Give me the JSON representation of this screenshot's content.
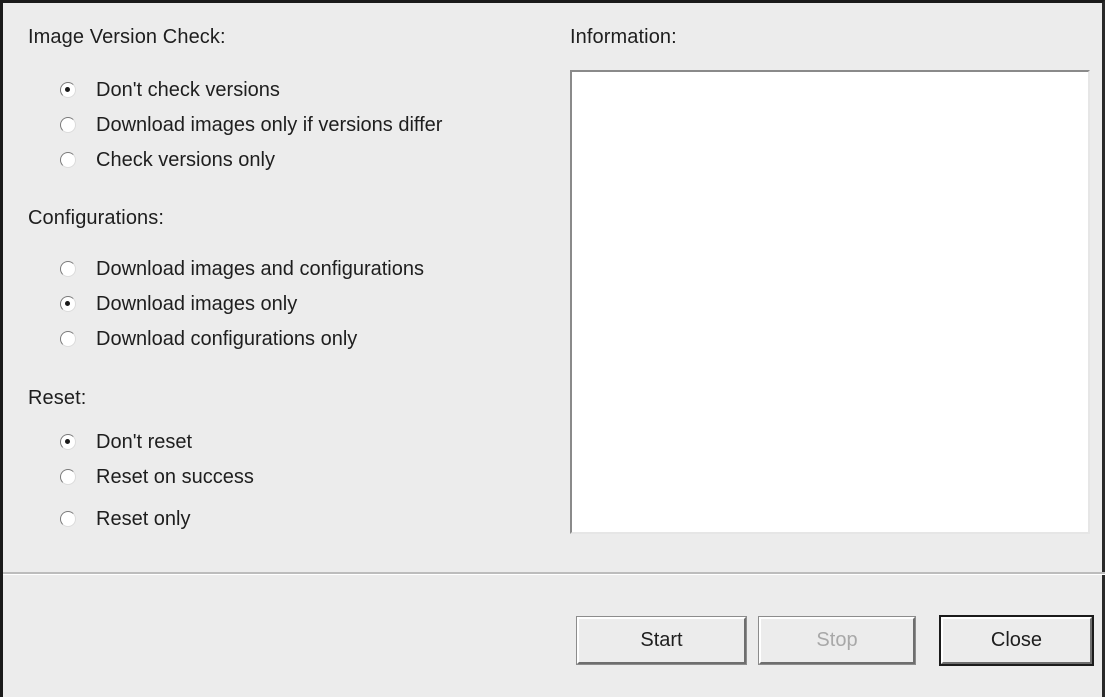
{
  "sections": {
    "image_version_check": {
      "heading": "Image Version Check:",
      "options": [
        {
          "label": "Don't check versions",
          "checked": true
        },
        {
          "label": "Download images only if versions differ",
          "checked": false
        },
        {
          "label": "Check versions only",
          "checked": false
        }
      ]
    },
    "configurations": {
      "heading": "Configurations:",
      "options": [
        {
          "label": "Download images and configurations",
          "checked": false
        },
        {
          "label": "Download images only",
          "checked": true
        },
        {
          "label": "Download configurations only",
          "checked": false
        }
      ]
    },
    "reset": {
      "heading": "Reset:",
      "options": [
        {
          "label": "Don't reset",
          "checked": true
        },
        {
          "label": "Reset on success",
          "checked": false
        },
        {
          "label": "Reset only",
          "checked": false
        }
      ]
    }
  },
  "information": {
    "heading": "Information:",
    "content": ""
  },
  "buttons": {
    "start": {
      "label": "Start",
      "enabled": true
    },
    "stop": {
      "label": "Stop",
      "enabled": false
    },
    "close": {
      "label": "Close",
      "enabled": true
    }
  }
}
